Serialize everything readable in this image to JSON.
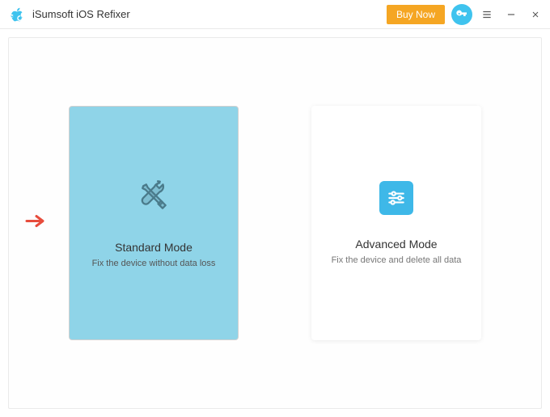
{
  "app": {
    "title": "iSumsoft iOS Refixer"
  },
  "titlebar": {
    "buy_now_label": "Buy Now"
  },
  "modes": {
    "standard": {
      "title": "Standard Mode",
      "description": "Fix the device without data loss"
    },
    "advanced": {
      "title": "Advanced Mode",
      "description": "Fix the device and delete all data"
    }
  },
  "colors": {
    "accent_orange": "#f5a623",
    "accent_blue": "#3fc3ee",
    "card_selected": "#8fd4e8"
  }
}
